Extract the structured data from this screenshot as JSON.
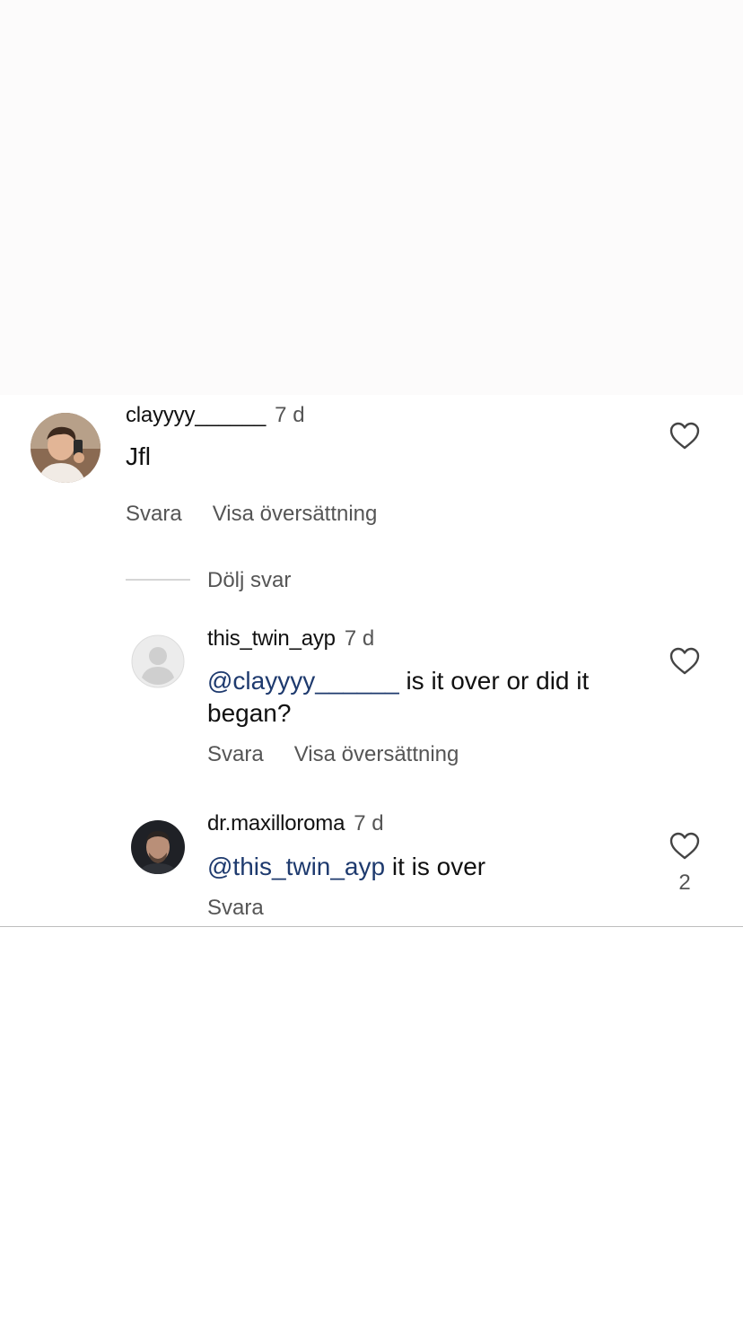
{
  "comments": [
    {
      "username": "clayyyy______",
      "time": "7 d",
      "text": "Jfl",
      "reply": "Svara",
      "translate": "Visa översättning",
      "avatar_icon": "profile-photo-selfie"
    },
    {
      "username": "this_twin_ayp",
      "time": "7 d",
      "mention": "@clayyyy______",
      "text": "is it over or did it began?",
      "reply": "Svara",
      "translate": "Visa översättning",
      "avatar_icon": "default-profile-icon"
    },
    {
      "username": "dr.maxilloroma",
      "time": "7 d",
      "mention": "@this_twin_ayp",
      "text": "it is over",
      "reply": "Svara",
      "likes": "2",
      "avatar_icon": "profile-photo-man"
    }
  ],
  "hide_replies": "Dölj svar",
  "colors": {
    "mention": "#1e3a6e",
    "secondary_text": "#555555",
    "primary_text": "#111111"
  }
}
